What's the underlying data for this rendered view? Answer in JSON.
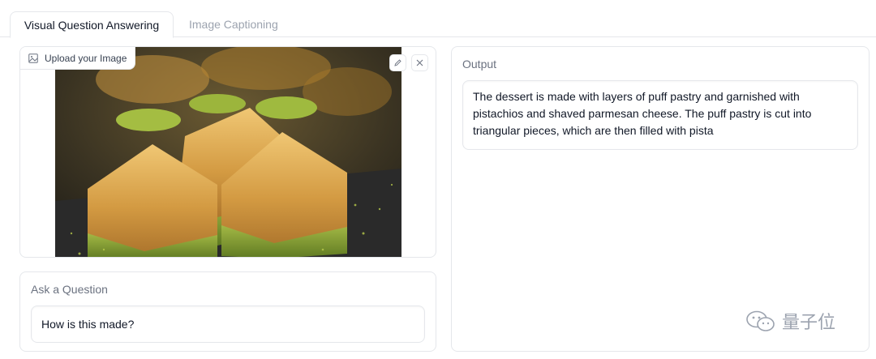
{
  "tabs": [
    {
      "label": "Visual Question Answering",
      "active": true
    },
    {
      "label": "Image Captioning",
      "active": false
    }
  ],
  "image_panel": {
    "label": "Upload your Image",
    "edit_icon": "pencil-icon",
    "clear_icon": "close-icon"
  },
  "question_panel": {
    "label": "Ask a Question",
    "value": "How is this made?"
  },
  "output_panel": {
    "label": "Output",
    "text": "The dessert is made with layers of puff pastry and garnished with pistachios and shaved parmesan cheese. The puff pastry is cut into triangular pieces, which are then filled with pista"
  },
  "watermark": {
    "text": "量子位",
    "icon": "wechat-icon"
  },
  "colors": {
    "border": "#e5e7eb",
    "muted_text": "#6b7280",
    "pastry": "#d9a54a",
    "pistachio": "#8aa834",
    "slate": "#2b2b2b"
  }
}
